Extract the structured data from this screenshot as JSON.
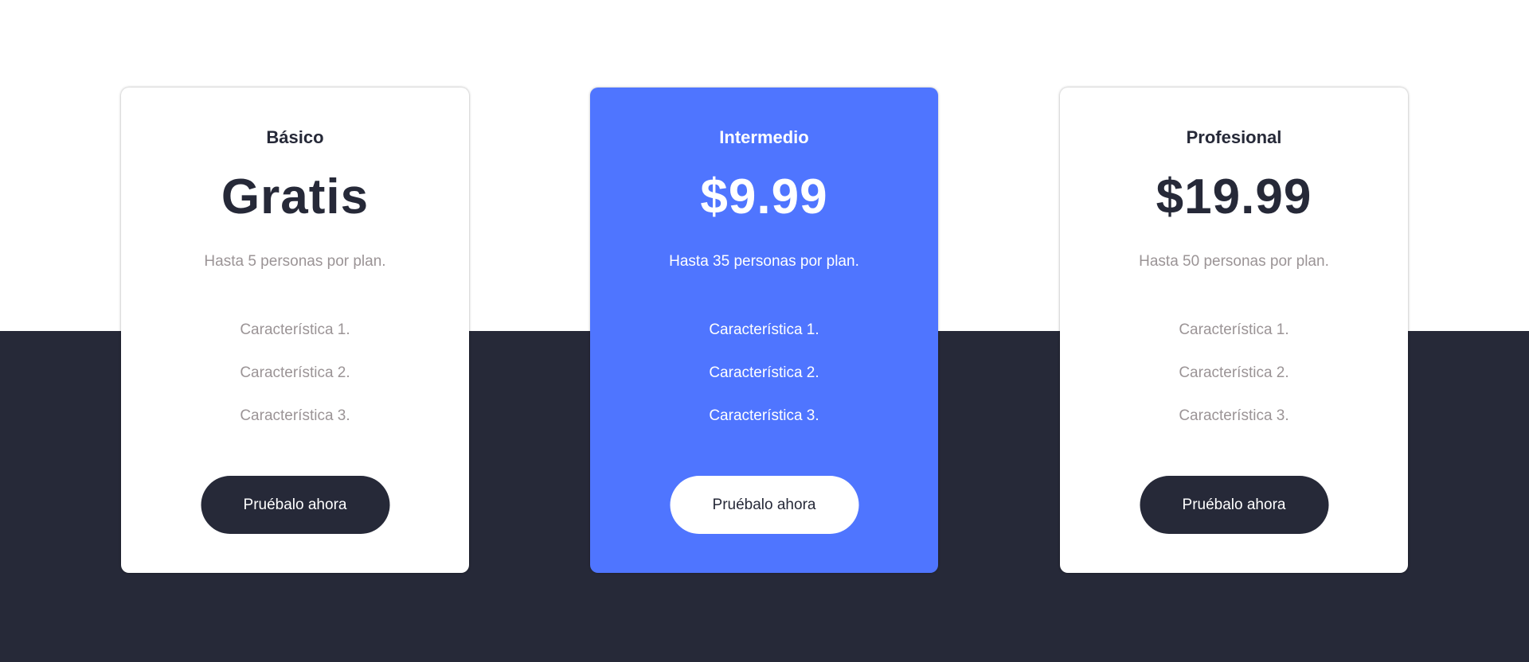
{
  "colors": {
    "dark": "#262938",
    "accent": "#4f75ff",
    "muted_text": "#9b9496",
    "white": "#ffffff"
  },
  "plans": [
    {
      "name": "Básico",
      "price": "Gratis",
      "description": "Hasta 5 personas por plan.",
      "features": [
        "Característica 1.",
        "Característica 2.",
        "Característica 3."
      ],
      "cta_label": "Pruébalo ahora",
      "featured": false
    },
    {
      "name": "Intermedio",
      "price": "$9.99",
      "description": "Hasta 35 personas por plan.",
      "features": [
        "Característica 1.",
        "Característica 2.",
        "Característica 3."
      ],
      "cta_label": "Pruébalo ahora",
      "featured": true
    },
    {
      "name": "Profesional",
      "price": "$19.99",
      "description": "Hasta 50 personas por plan.",
      "features": [
        "Característica 1.",
        "Característica 2.",
        "Característica 3."
      ],
      "cta_label": "Pruébalo ahora",
      "featured": false
    }
  ]
}
